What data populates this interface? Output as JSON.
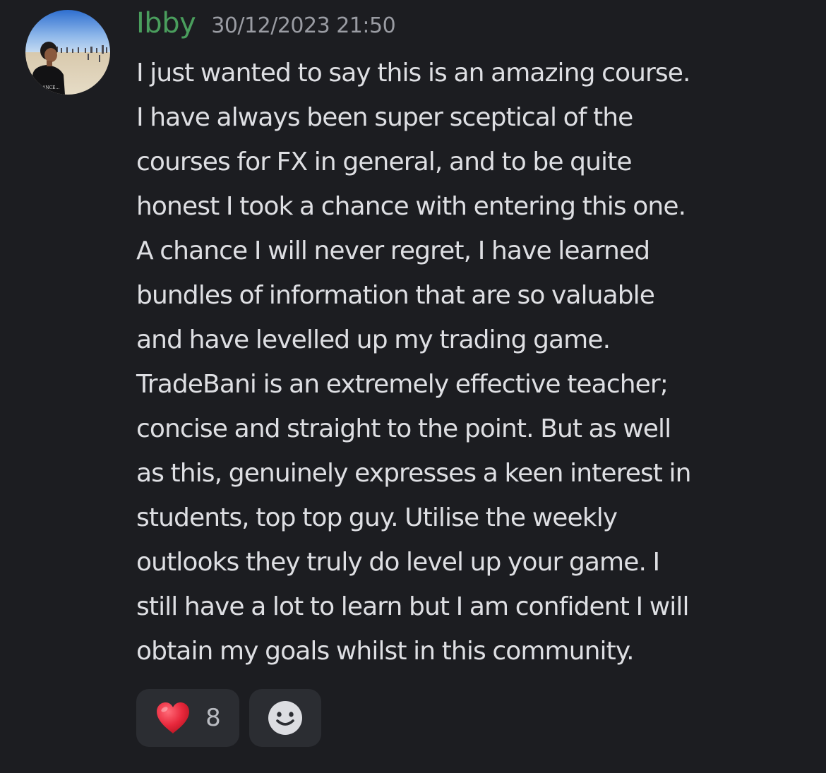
{
  "message": {
    "author": "Ibby",
    "timestamp": "30/12/2023 21:50",
    "lines": [
      "I just wanted to say this is an amazing course.",
      "I have always been super sceptical of the",
      "courses for FX in general, and to be quite",
      "honest I took a chance with entering this one.",
      "A chance I will never regret, I have learned",
      "bundles of information that are so valuable",
      "and have levelled up my trading game.",
      "TradeBani is an extremely effective teacher;",
      "concise and straight to the point. But as well",
      "as this, genuinely expresses a keen interest in",
      "students, top top guy. Utilise the weekly",
      "outlooks they truly do level up your game. I",
      "still have a lot to learn but I am confident I will",
      "obtain my goals whilst in this community."
    ],
    "avatar_shirt_text": "ANCE...",
    "reactions": [
      {
        "icon": "heart-icon",
        "emoji": "❤",
        "count": "8"
      },
      {
        "icon": "add-reaction-smiley-icon"
      }
    ]
  },
  "colors": {
    "background": "#1c1d21",
    "username": "#4a9e5d",
    "timestamp": "#9a9ca3",
    "text": "#dedfe3",
    "reaction_background": "#2b2d32",
    "heart": "#e8283c"
  }
}
